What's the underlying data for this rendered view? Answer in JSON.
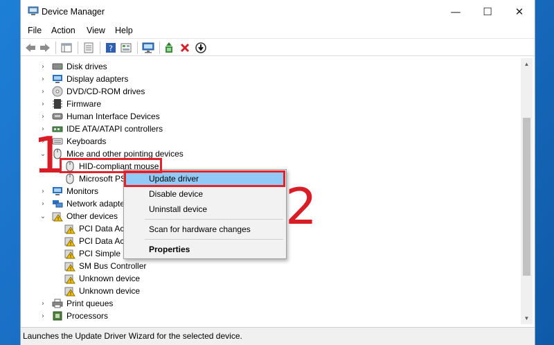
{
  "window": {
    "title": "Device Manager",
    "icon": "device-manager-icon"
  },
  "window_controls": {
    "minimize": "—",
    "maximize": "☐",
    "close": "✕"
  },
  "menu": [
    "File",
    "Action",
    "View",
    "Help"
  ],
  "toolbar": {
    "buttons": [
      "back-icon",
      "forward-icon",
      "properties-icon",
      "show-hide-icon",
      "help-icon",
      "scan-icon",
      "monitor-icon",
      "update-driver-icon",
      "uninstall-icon",
      "disable-icon"
    ]
  },
  "tree": [
    {
      "label": "Disk drives",
      "icon": "disk-icon",
      "expanded": false
    },
    {
      "label": "Display adapters",
      "icon": "display-icon",
      "expanded": false
    },
    {
      "label": "DVD/CD-ROM drives",
      "icon": "dvd-icon",
      "expanded": false
    },
    {
      "label": "Firmware",
      "icon": "firmware-icon",
      "expanded": false
    },
    {
      "label": "Human Interface Devices",
      "icon": "hid-icon",
      "expanded": false
    },
    {
      "label": "IDE ATA/ATAPI controllers",
      "icon": "ide-icon",
      "expanded": false
    },
    {
      "label": "Keyboards",
      "icon": "keyboard-icon",
      "expanded": false
    },
    {
      "label": "Mice and other pointing devices",
      "icon": "mouse-icon",
      "expanded": true
    },
    {
      "label": "HID-compliant mouse",
      "icon": "mouse-icon",
      "child": true
    },
    {
      "label": "Microsoft PS",
      "icon": "mouse-icon",
      "child": true
    },
    {
      "label": "Monitors",
      "icon": "monitor-icon",
      "expanded": false
    },
    {
      "label": "Network adapter",
      "icon": "network-icon",
      "expanded": false
    },
    {
      "label": "Other devices",
      "icon": "warning-icon",
      "expanded": true
    },
    {
      "label": "PCI Data Acc",
      "icon": "warning-icon",
      "child": true
    },
    {
      "label": "PCI Data Acc",
      "icon": "warning-icon",
      "child": true
    },
    {
      "label": "PCI Simple C",
      "icon": "warning-icon",
      "child": true
    },
    {
      "label": "SM Bus Controller",
      "icon": "warning-icon",
      "child": true
    },
    {
      "label": "Unknown device",
      "icon": "warning-icon",
      "child": true
    },
    {
      "label": "Unknown device",
      "icon": "warning-icon",
      "child": true
    },
    {
      "label": "Print queues",
      "icon": "printer-icon",
      "expanded": false
    },
    {
      "label": "Processors",
      "icon": "processor-icon",
      "expanded": false
    }
  ],
  "context_menu": {
    "items": [
      "Update driver",
      "Disable device",
      "Uninstall device",
      "Scan for hardware changes",
      "Properties"
    ],
    "highlighted": "Update driver"
  },
  "annotations": {
    "step1": "1",
    "step2": "2",
    "highlight_color": "#e3232c"
  },
  "status_bar": "Launches the Update Driver Wizard for the selected device.",
  "colors": {
    "selection": "#91c9f7",
    "accent_red": "#e3232c",
    "desktop": "#1a6fc4"
  }
}
